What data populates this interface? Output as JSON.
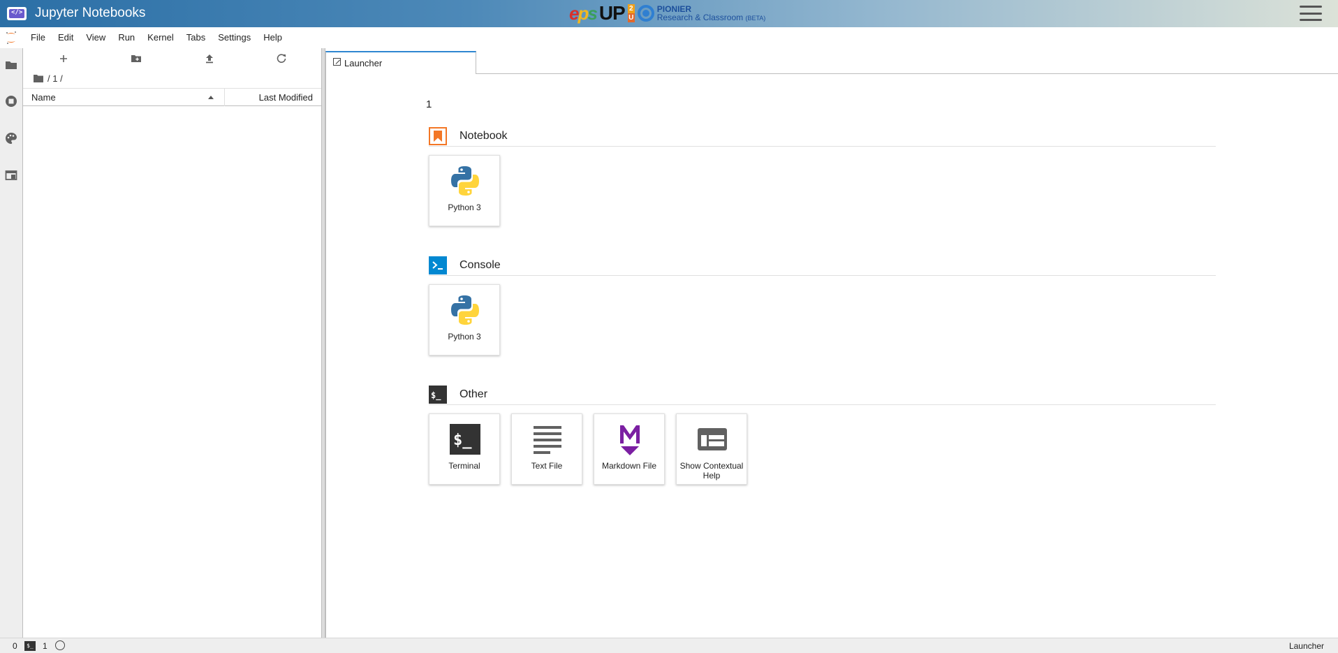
{
  "app": {
    "title": "Jupyter Notebooks",
    "logo_glyph": "</>"
  },
  "brand": {
    "ep_e": "e",
    "ep_p": "p",
    "ep_s": "s",
    "up": "UP",
    "up_2": "2",
    "up_u": "U",
    "pionier": "PIONIER",
    "subtitle": "Research & Classroom",
    "beta": "(BETA)"
  },
  "menu": [
    "File",
    "Edit",
    "View",
    "Run",
    "Kernel",
    "Tabs",
    "Settings",
    "Help"
  ],
  "file_browser": {
    "breadcrumb": "/ 1 /",
    "columns": {
      "name": "Name",
      "modified": "Last Modified"
    }
  },
  "tabs": [
    {
      "label": "Launcher",
      "active": true
    }
  ],
  "launcher": {
    "cwd": "1",
    "sections": {
      "notebook": {
        "title": "Notebook",
        "cards": [
          "Python 3"
        ]
      },
      "console": {
        "title": "Console",
        "cards": [
          "Python 3"
        ]
      },
      "other": {
        "title": "Other",
        "cards": [
          "Terminal",
          "Text File",
          "Markdown File",
          "Show Contextual Help"
        ]
      }
    }
  },
  "status": {
    "terminals": "0",
    "kernels": "1",
    "mode": "Launcher",
    "term_glyph": "$_"
  },
  "colors": {
    "accent": "#2f86d1",
    "notebook": "#f37726",
    "console": "#0288d1",
    "markdown": "#7b1fa2"
  },
  "icons": {
    "sidebar": [
      "folder-icon",
      "running-icon",
      "palette-icon",
      "tabs-icon"
    ],
    "toolbar": [
      "plus-icon",
      "new-folder-icon",
      "upload-icon",
      "refresh-icon"
    ]
  }
}
